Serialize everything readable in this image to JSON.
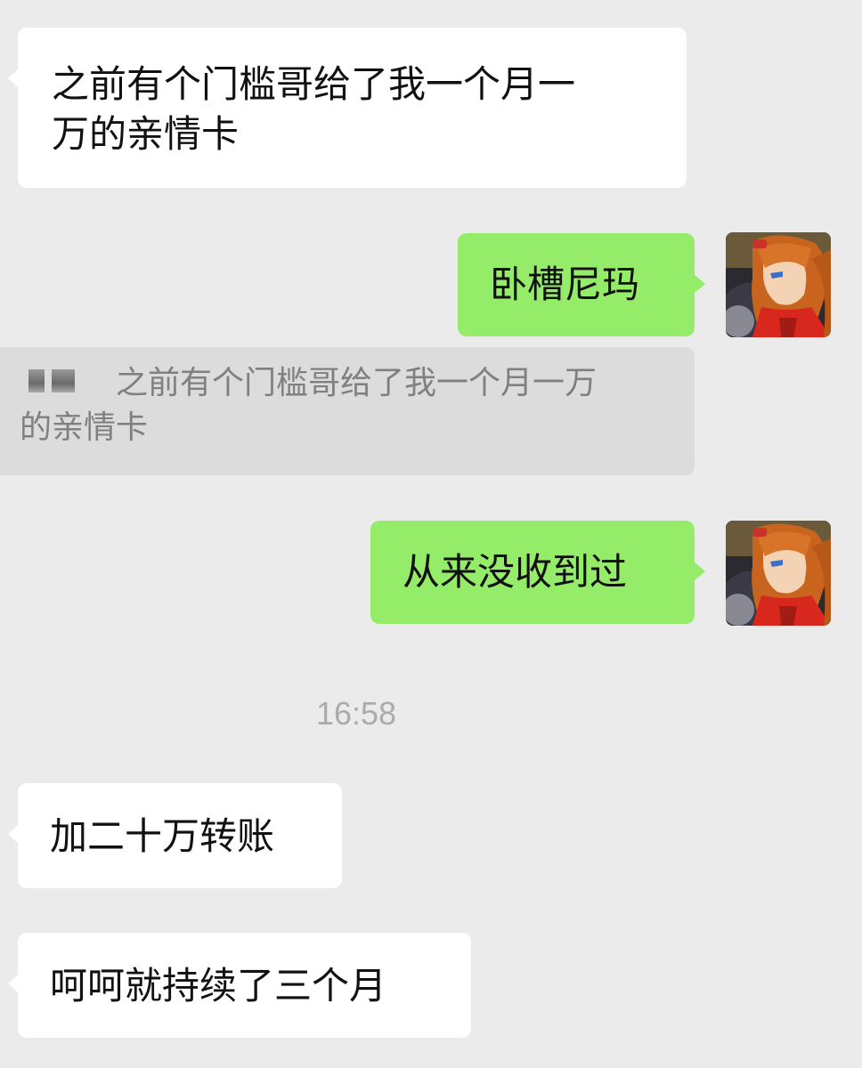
{
  "messages": [
    {
      "side": "in",
      "text_line1": "之前有个门槛哥给了我一个月一",
      "text_line2": "万的亲情卡"
    },
    {
      "side": "out",
      "text": "卧槽尼玛"
    },
    {
      "quote": {
        "sender": "",
        "text_line1": "之前有个门槛哥给了我一个月一万",
        "text_line2": "的亲情卡"
      }
    },
    {
      "side": "out",
      "text": "从来没收到过"
    },
    {
      "time": "16:58"
    },
    {
      "side": "in",
      "text": "加二十万转账"
    },
    {
      "side": "in",
      "text": "呵呵就持续了三个月"
    }
  ],
  "colors": {
    "background": "#ebebeb",
    "incoming_bubble": "#ffffff",
    "outgoing_bubble": "#95ec69",
    "quote_background": "#dcdcdc",
    "quote_text": "#808080",
    "timestamp": "#ababab"
  },
  "avatar": {
    "icon": "anime-avatar-icon"
  }
}
